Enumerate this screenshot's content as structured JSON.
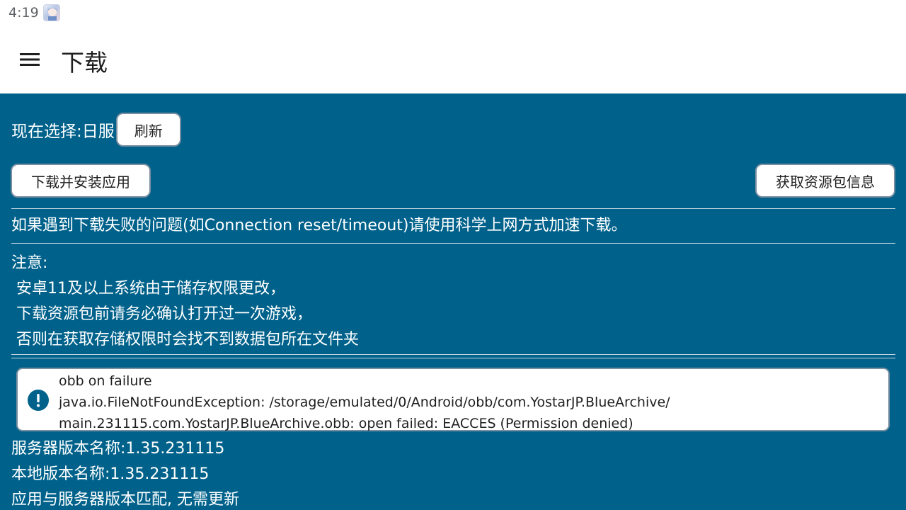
{
  "status_bar": {
    "time": "4:19",
    "app_icon": "app-avatar-icon"
  },
  "app_bar": {
    "menu_icon": "hamburger-menu-icon",
    "title": "下载"
  },
  "content": {
    "background_color": "#00628b",
    "selection_label": "现在选择:日服",
    "refresh_button": "刷新",
    "install_button": "下载并安装应用",
    "resource_info_button": "获取资源包信息",
    "connection_tip": "如果遇到下载失败的问题(如Connection reset/timeout)请使用科学上网方式加速下载。",
    "note": {
      "heading": "注意:",
      "lines": [
        " 安卓11及以上系统由于储存权限更改，",
        " 下载资源包前请务必确认打开过一次游戏，",
        " 否则在获取存储权限时会找不到数据包所在文件夹"
      ]
    },
    "error": {
      "icon": "alert-circle-icon",
      "lines": [
        "obb on failure",
        "java.io.FileNotFoundException: /storage/emulated/0/Android/obb/com.YostarJP.BlueArchive/",
        "main.231115.com.YostarJP.BlueArchive.obb: open failed: EACCES (Permission denied)"
      ]
    },
    "version_info": [
      "服务器版本名称:1.35.231115",
      "本地版本名称:1.35.231115",
      "应用与服务器版本匹配, 无需更新"
    ]
  }
}
